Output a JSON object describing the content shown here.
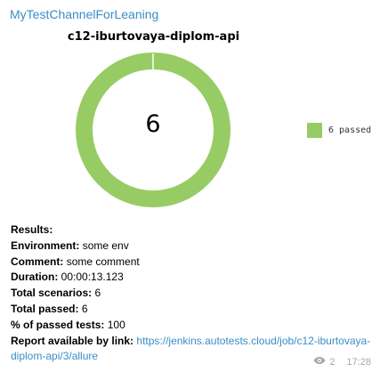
{
  "channel": {
    "name": "MyTestChannelForLeaning"
  },
  "chart_data": {
    "type": "pie",
    "title": "c12-iburtovaya-diplom-api",
    "center_label": "6",
    "slices": [
      {
        "name": "6 passed",
        "value": 6,
        "color": "#97cc64"
      }
    ],
    "legend_position": "right"
  },
  "report": {
    "results_label": "Results:",
    "environment_label": "Environment:",
    "environment_value": "some env",
    "comment_label": "Comment:",
    "comment_value": "some comment",
    "duration_label": "Duration:",
    "duration_value": "00:00:13.123",
    "total_scenarios_label": "Total scenarios:",
    "total_scenarios_value": "6",
    "total_passed_label": "Total passed:",
    "total_passed_value": "6",
    "percent_label": "% of passed tests:",
    "percent_value": "100",
    "link_label": "Report available by link:",
    "link_value": "https://jenkins.autotests.cloud/job/c12-iburtovaya-diplom-api/3/allure"
  },
  "footer": {
    "views": "2",
    "time": "17:28",
    "views_icon": "eye-icon"
  }
}
